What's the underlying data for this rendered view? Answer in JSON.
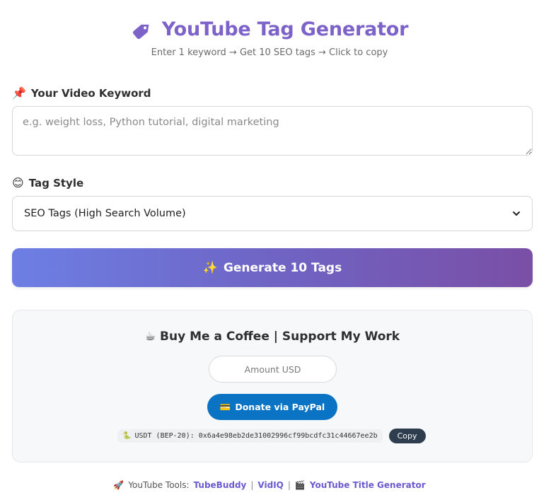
{
  "header": {
    "title": "YouTube Tag Generator",
    "subtitle": "Enter 1 keyword → Get 10 SEO tags → Click to copy",
    "title_color": "#7d63c9",
    "icon": "tag-icon"
  },
  "keyword": {
    "label": "Your Video Keyword",
    "label_icon": "📌",
    "placeholder": "e.g. weight loss, Python tutorial, digital marketing",
    "value": ""
  },
  "style": {
    "label": "Tag Style",
    "label_icon": "😊",
    "selected": "SEO Tags (High Search Volume)"
  },
  "generate": {
    "icon": "✨",
    "label": "Generate 10 Tags",
    "gradient": [
      "#6d7fe4",
      "#7a4fa6"
    ]
  },
  "support": {
    "icon": "☕",
    "title": "Buy Me a Coffee | Support My Work",
    "amount_placeholder": "Amount USD",
    "paypal_icon": "💳",
    "paypal_label": "Donate via PayPal",
    "paypal_color": "#0b73c4",
    "usdt_icon": "🐍",
    "usdt_text": "USDT (BEP-20): 0x6a4e98eb2de31002996cf99bcdfc31c44667ee2b",
    "copy_label": "Copy"
  },
  "footer": {
    "icon": "🚀",
    "prefix": "YouTube Tools:",
    "links": [
      "TubeBuddy",
      "VidIQ"
    ],
    "title_gen_icon": "🎬",
    "title_gen_label": "YouTube Title Generator",
    "separator": "|"
  }
}
